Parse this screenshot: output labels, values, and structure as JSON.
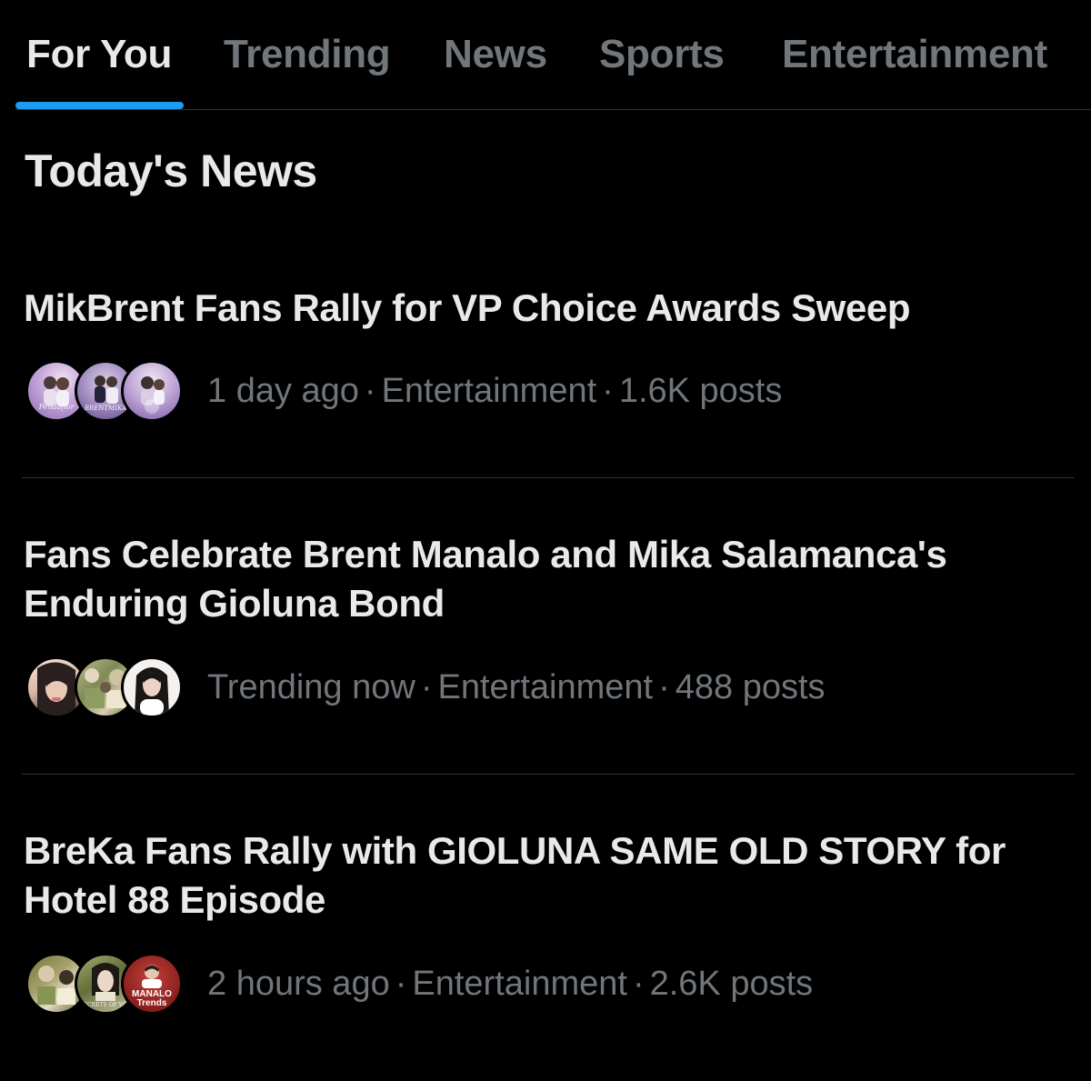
{
  "tabs": [
    {
      "label": "For You",
      "active": true
    },
    {
      "label": "Trending",
      "active": false
    },
    {
      "label": "News",
      "active": false
    },
    {
      "label": "Sports",
      "active": false
    },
    {
      "label": "Entertainment",
      "active": false
    }
  ],
  "section": {
    "title": "Today's News"
  },
  "colors": {
    "background": "#000000",
    "text_primary": "#e7e9ea",
    "text_secondary": "#71767b",
    "accent": "#1d9bf0",
    "divider": "#2f3336"
  },
  "news": [
    {
      "headline": "MikBrent Fans Rally for VP Choice Awards Sweep",
      "time": "1 day ago",
      "category": "Entertainment",
      "posts": "1.6K posts",
      "avatars": [
        {
          "icon": "couple-photo-avatar",
          "caption": "Pendaflor"
        },
        {
          "icon": "couple-photo-avatar",
          "caption": "BRENTMIKA"
        },
        {
          "icon": "couple-photo-avatar",
          "caption": ""
        }
      ]
    },
    {
      "headline": "Fans Celebrate Brent Manalo and Mika Salamanca's Enduring Gioluna Bond",
      "time": "Trending now",
      "category": "Entertainment",
      "posts": "488 posts",
      "avatars": [
        {
          "icon": "portrait-avatar",
          "caption": ""
        },
        {
          "icon": "collage-avatar",
          "caption": ""
        },
        {
          "icon": "portrait-avatar",
          "caption": ""
        }
      ]
    },
    {
      "headline": "BreKa Fans Rally with GIOLUNA SAME OLD STORY for Hotel 88 Episode",
      "time": "2 hours ago",
      "category": "Entertainment",
      "posts": "2.6K posts",
      "avatars": [
        {
          "icon": "collage-avatar",
          "caption": ""
        },
        {
          "icon": "collage-avatar",
          "caption": "SECRETS OF YOU"
        },
        {
          "icon": "logo-avatar",
          "caption": "MANALO Trends"
        }
      ]
    }
  ]
}
